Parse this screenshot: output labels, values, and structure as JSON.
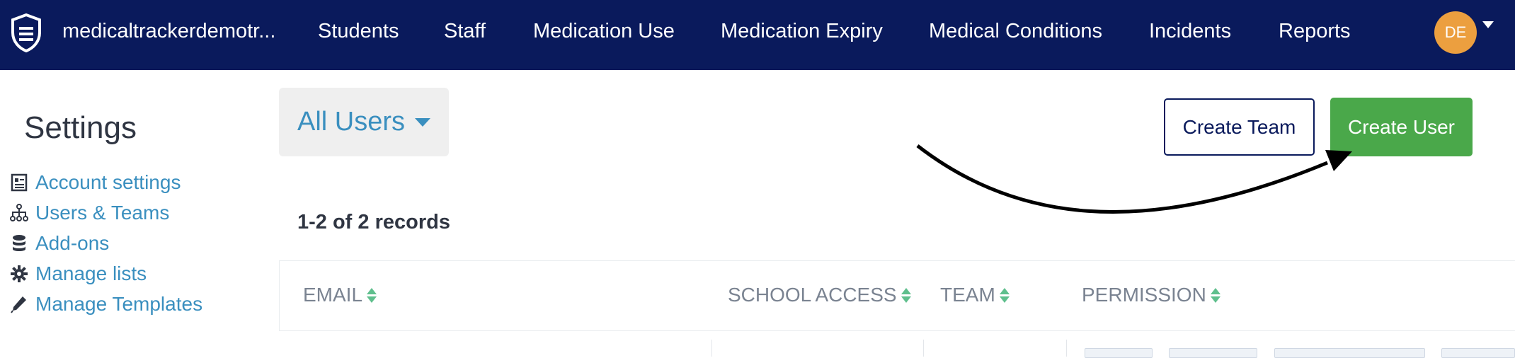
{
  "navbar": {
    "brand": "medicaltrackerdemotr...",
    "items": [
      "Students",
      "Staff",
      "Medication Use",
      "Medication Expiry",
      "Medical Conditions",
      "Incidents",
      "Reports"
    ],
    "avatar_initials": "DE",
    "bg_color": "#0a1a5c"
  },
  "sidebar": {
    "title": "Settings",
    "items": [
      {
        "label": "Account settings",
        "icon": "document-icon"
      },
      {
        "label": "Users & Teams",
        "icon": "org-chart-icon"
      },
      {
        "label": "Add-ons",
        "icon": "database-icon"
      },
      {
        "label": "Manage lists",
        "icon": "gear-icon"
      },
      {
        "label": "Manage Templates",
        "icon": "pencil-icon"
      }
    ]
  },
  "filter": {
    "label": "All Users"
  },
  "actions": {
    "create_team": "Create Team",
    "create_user": "Create User"
  },
  "records": {
    "summary": "1-2 of 2 records"
  },
  "table": {
    "columns": [
      "EMAIL",
      "SCHOOL ACCESS",
      "TEAM",
      "PERMISSION"
    ]
  },
  "colors": {
    "accent": "#3a8fbf",
    "primary_button": "#4aa84a",
    "avatar": "#ec9f3f"
  }
}
